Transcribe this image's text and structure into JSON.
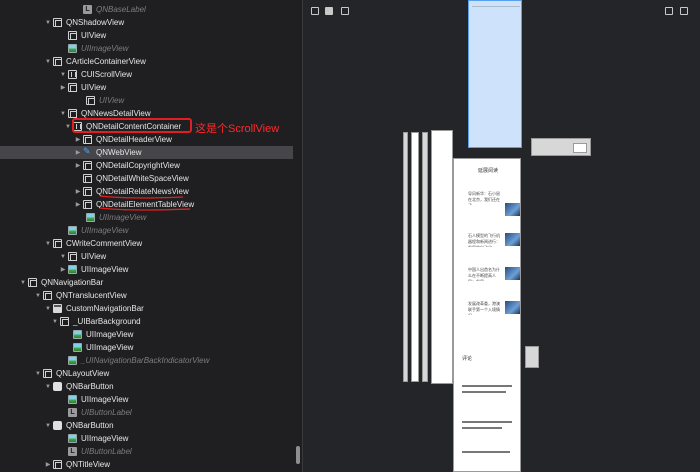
{
  "tree": {
    "rows": [
      {
        "label": "QNBaseLabel",
        "icon": "label-icon",
        "dim": true
      },
      {
        "label": "QNShadowView",
        "icon": "view-icon"
      },
      {
        "label": "UIView",
        "icon": "view-icon"
      },
      {
        "label": "UIImageView",
        "icon": "image-icon",
        "dim": true
      },
      {
        "label": "CArticleContainerView",
        "icon": "view-icon"
      },
      {
        "label": "CUIScrollView",
        "icon": "scroll-icon"
      },
      {
        "label": "UIView",
        "icon": "view-icon"
      },
      {
        "label": "UIView",
        "icon": "view-icon",
        "dim": true
      },
      {
        "label": "QNNewsDetailView",
        "icon": "view-icon"
      },
      {
        "label": "QNDetailContentContainer",
        "icon": "scroll-icon"
      },
      {
        "label": "QNDetailHeaderView",
        "icon": "view-icon"
      },
      {
        "label": "QNWebView",
        "icon": "web-icon",
        "selected": true
      },
      {
        "label": "QNDetailCopyrightView",
        "icon": "view-icon"
      },
      {
        "label": "QNDetailWhiteSpaceView",
        "icon": "view-icon"
      },
      {
        "label": "QNDetailRelateNewsView",
        "icon": "view-icon"
      },
      {
        "label": "QNDetailElementTableView",
        "icon": "view-icon"
      },
      {
        "label": "UIImageView",
        "icon": "image-icon",
        "dim": true
      },
      {
        "label": "UIImageView",
        "icon": "image-icon",
        "dim": true
      },
      {
        "label": "CWriteCommentView",
        "icon": "view-icon"
      },
      {
        "label": "UIView",
        "icon": "view-icon"
      },
      {
        "label": "UIImageView",
        "icon": "image-icon"
      },
      {
        "label": "QNNavigationBar",
        "icon": "view-icon"
      },
      {
        "label": "QNTranslucentView",
        "icon": "view-icon"
      },
      {
        "label": "CustomNavigationBar",
        "icon": "navbar-icon"
      },
      {
        "label": "_UIBarBackground",
        "icon": "view-icon"
      },
      {
        "label": "UIImageView",
        "icon": "image-icon"
      },
      {
        "label": "UIImageView",
        "icon": "image-icon"
      },
      {
        "label": "_UINavigationBarBackIndicatorView",
        "icon": "image-icon",
        "dim": true
      },
      {
        "label": "QNLayoutView",
        "icon": "view-icon"
      },
      {
        "label": "QNBarButton",
        "icon": "button-icon"
      },
      {
        "label": "UIImageView",
        "icon": "image-icon"
      },
      {
        "label": "UIButtonLabel",
        "icon": "label-icon",
        "dim": true
      },
      {
        "label": "QNBarButton",
        "icon": "button-icon"
      },
      {
        "label": "UIImageView",
        "icon": "image-icon"
      },
      {
        "label": "UIButtonLabel",
        "icon": "label-icon",
        "dim": true
      },
      {
        "label": "QNTitleView",
        "icon": "view-icon"
      }
    ]
  },
  "annotation": {
    "text": "这是个ScrollView",
    "color": "#ff2a2a"
  },
  "canvas": {
    "phone": {
      "section_heading": "延展阅读",
      "news": [
        "导风新华：石小鼠在北京，我们还在了",
        "石人模型的飞行机器程和新闻进行：发展的自动化",
        "中国人出首名为什么在不断提高人民：发展",
        "发展改革委，港澳联手第一个入境情况"
      ],
      "comment_tab": "评论"
    }
  },
  "colors": {
    "selected_row": "#46464a",
    "web_icon": "#4aa3ff",
    "highlight": "#e02020"
  }
}
